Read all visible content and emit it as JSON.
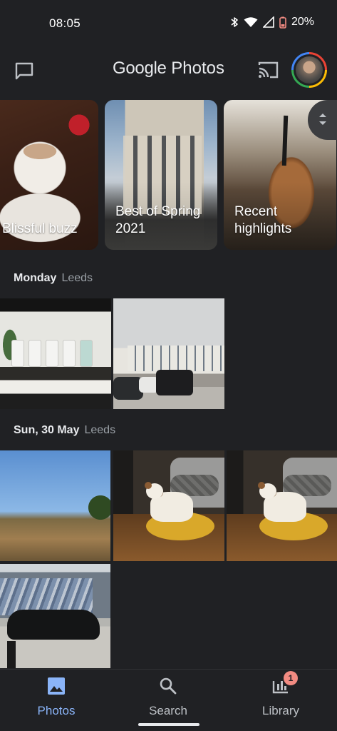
{
  "status_bar": {
    "time": "08:05",
    "battery": "20%",
    "icons": [
      "bluetooth-icon",
      "wifi-icon",
      "signal-icon",
      "battery-icon"
    ]
  },
  "header": {
    "title_google": "Google",
    "title_photos": "Photos",
    "left_icon": "chat-icon",
    "cast_icon": "cast-icon"
  },
  "memories": [
    {
      "label": "Blissful buzz"
    },
    {
      "label": "Best of Spring 2021"
    },
    {
      "label": "Recent highlights"
    }
  ],
  "sections": [
    {
      "day": "Monday",
      "place": "Leeds"
    },
    {
      "day": "Sun, 30 May",
      "place": "Leeds"
    }
  ],
  "nav": {
    "photos": "Photos",
    "search": "Search",
    "library": "Library",
    "library_badge": "1"
  },
  "colors": {
    "background": "#202124",
    "accent": "#8ab4f8",
    "badge": "#f28b82"
  }
}
